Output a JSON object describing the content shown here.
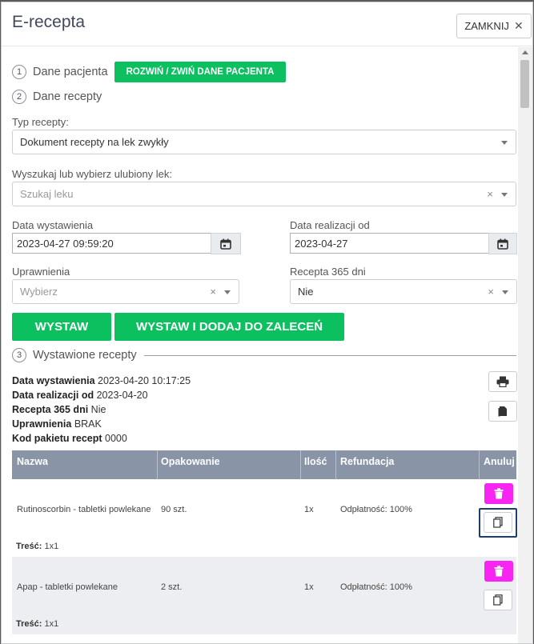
{
  "modal": {
    "title": "E-recepta",
    "close_label": "ZAMKNIJ",
    "close_symbol": "✕"
  },
  "steps": [
    {
      "num": "1",
      "label": "Dane pacjenta"
    },
    {
      "num": "2",
      "label": "Dane recepty"
    },
    {
      "num": "3",
      "label": "Wystawione recepty"
    }
  ],
  "toggle_patient_button": "ROZWIŃ / ZWIŃ DANE PACJENTA",
  "form": {
    "typ_label": "Typ recepty:",
    "typ_value": "Dokument recepty na lek zwykły",
    "search_label": "Wyszukaj lub wybierz ulubiony lek:",
    "search_placeholder": "Szukaj leku",
    "data_wyst_label": "Data wystawienia",
    "data_wyst_value": "2023-04-27 09:59:20",
    "data_real_label": "Data realizacji od",
    "data_real_value": "2023-04-27",
    "uprawnienia_label": "Uprawnienia",
    "uprawnienia_placeholder": "Wybierz",
    "recepta365_label": "Recepta 365 dni",
    "recepta365_value": "Nie",
    "clear_symbol": "×"
  },
  "actions": {
    "wystaw": "WYSTAW",
    "wystaw_dodaj": "WYSTAW I DODAJ DO ZALECEŃ"
  },
  "issued": {
    "fields": [
      {
        "key": "Data wystawienia",
        "value": "2023-04-20 10:17:25"
      },
      {
        "key": "Data realizacji od",
        "value": "2023-04-20"
      },
      {
        "key": "Recepta 365 dni",
        "value": "Nie"
      },
      {
        "key": "Uprawnienia",
        "value": "BRAK"
      },
      {
        "key": "Kod pakietu recept",
        "value": "0000"
      }
    ],
    "print_icon": "printer-icon",
    "copy_icon": "clipboard-icon"
  },
  "table": {
    "columns": [
      "Nazwa",
      "Opakowanie",
      "Ilość",
      "Refundacja",
      "Anuluj"
    ],
    "rows": [
      {
        "nazwa": "Rutinoscorbin - tabletki powlekane",
        "opakowanie": "90 szt.",
        "ilosc": "1x",
        "refundacja": "Odpłatność: 100%",
        "tresc_label": "Treść:",
        "tresc_value": "1x1"
      },
      {
        "nazwa": "Apap - tabletki powlekane",
        "opakowanie": "2 szt.",
        "ilosc": "1x",
        "refundacja": "Odpłatność: 100%",
        "tresc_label": "Treść:",
        "tresc_value": "1x1"
      }
    ]
  },
  "colors": {
    "green": "#0cc060",
    "header_bg": "#8995a6",
    "delete": "#f724f2",
    "row_alt": "#eceef1"
  }
}
